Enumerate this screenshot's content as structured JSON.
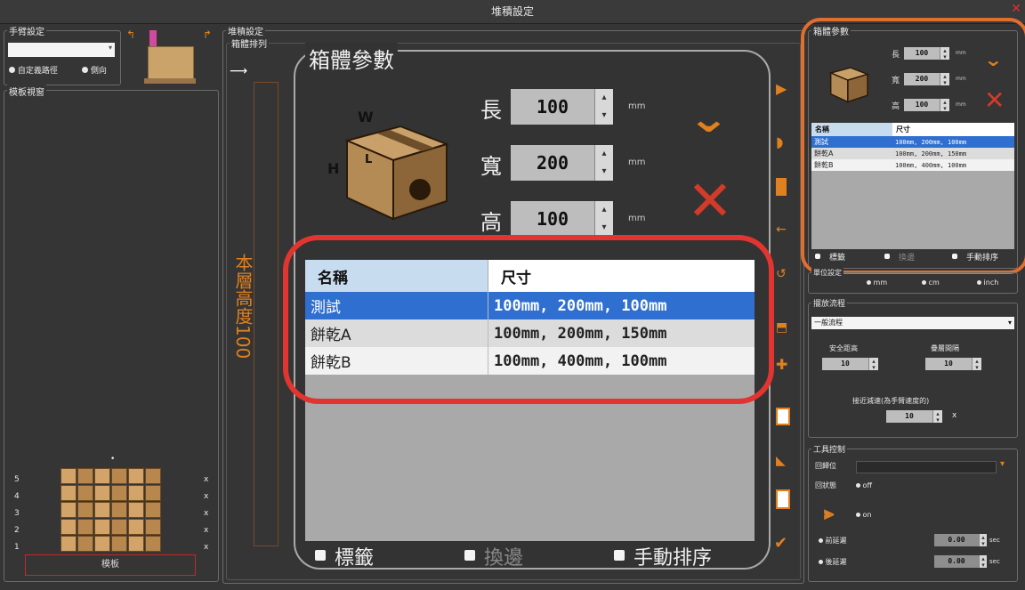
{
  "window": {
    "title": "堆積設定"
  },
  "left": {
    "hand_group": "手臂設定",
    "opt_custom": "自定義路徑",
    "opt_side": "側向",
    "template_group": "模板視窗",
    "template_label": "模板",
    "rows": [
      "5",
      "4",
      "3",
      "2",
      "1"
    ],
    "row_marks": [
      "x",
      "x",
      "x",
      "x",
      "x"
    ]
  },
  "center": {
    "stack_group": "堆積設定",
    "box_order": "箱體排列",
    "layer_height": "本層高度100"
  },
  "dialog": {
    "title": "箱體參數",
    "fields": [
      {
        "label": "長",
        "value": "100",
        "unit": "mm"
      },
      {
        "label": "寬",
        "value": "200",
        "unit": "mm"
      },
      {
        "label": "高",
        "value": "100",
        "unit": "mm"
      }
    ],
    "box_letters": {
      "w": "W",
      "l": "L",
      "h": "H"
    },
    "table": {
      "headers": [
        "名稱",
        "尺寸"
      ],
      "rows": [
        {
          "name": "測試",
          "size": "100mm, 200mm, 100mm",
          "selected": true
        },
        {
          "name": "餅乾A",
          "size": "100mm, 200mm, 150mm",
          "selected": false
        },
        {
          "name": "餅乾B",
          "size": "100mm, 400mm, 100mm",
          "selected": false
        }
      ]
    },
    "checkboxes": [
      "標籤",
      "換邊",
      "手動排序"
    ]
  },
  "right": {
    "box_group": "箱體參數",
    "fields": [
      {
        "label": "長",
        "value": "100",
        "unit": "mm"
      },
      {
        "label": "寬",
        "value": "200",
        "unit": "mm"
      },
      {
        "label": "高",
        "value": "100",
        "unit": "mm"
      }
    ],
    "table": {
      "headers": [
        "名稱",
        "尺寸"
      ],
      "rows": [
        {
          "name": "測試",
          "size": "100mm, 200mm, 100mm",
          "selected": true
        },
        {
          "name": "餅乾A",
          "size": "100mm, 200mm, 150mm",
          "selected": false
        },
        {
          "name": "餅乾B",
          "size": "100mm, 400mm, 100mm",
          "selected": false
        }
      ]
    },
    "checkboxes": [
      "標籤",
      "換邊",
      "手動排序"
    ],
    "unit_group": "單位設定",
    "units": [
      "mm",
      "cm",
      "inch"
    ],
    "flow_group": "擺放流程",
    "flow_value": "一般流程",
    "safe_height": "安全距高",
    "safe_value": "10",
    "gap": "疊層間隔",
    "gap_value": "10",
    "reduce_label": "接近減速(為手臂速度的)",
    "reduce_value": "10",
    "reduce_unit": "x",
    "tool_group": "工具控制",
    "tool_pos": "回歸位",
    "tool_status": "回狀態",
    "off": "off",
    "on": "on",
    "delay1": "前延遲",
    "delay2": "後延遲",
    "delay_val": "0.00",
    "sec": "sec"
  },
  "colors": {
    "accent": "#e0801e",
    "highlight": "#e03530",
    "selection": "#2f6fd0"
  }
}
